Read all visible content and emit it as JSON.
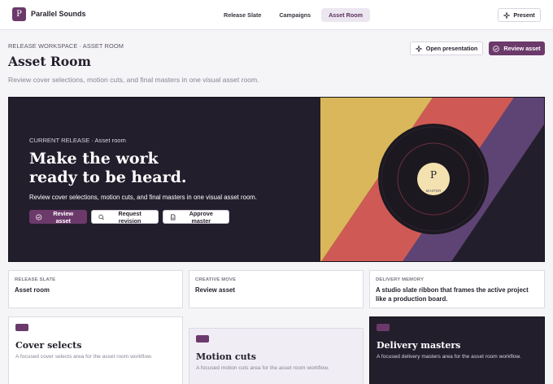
{
  "app": {
    "logo_letter": "P",
    "brand": "Parallel Sounds",
    "present_label": "Present"
  },
  "nav": {
    "items": [
      {
        "label": "Release Slate",
        "active": false
      },
      {
        "label": "Campaigns",
        "active": false
      },
      {
        "label": "Asset Room",
        "active": true
      }
    ]
  },
  "header": {
    "eyebrow": "RELEASE WORKSPACE · ASSET ROOM",
    "title": "Asset Room",
    "subtitle": "Review cover selections, motion cuts, and final masters in one visual asset room.",
    "open_label": "Open presentation",
    "review_label": "Review asset"
  },
  "hero": {
    "eyebrow": "CURRENT RELEASE · Asset room",
    "title_line1": "Make the work",
    "title_line2": "ready to be heard.",
    "description": "Review cover selections, motion cuts, and final masters in one visual asset room.",
    "buttons": {
      "review": "Review asset",
      "revision": "Request revision",
      "approve": "Approve master"
    },
    "record": {
      "letter": "P",
      "label": "MASTER"
    }
  },
  "info_cards": [
    {
      "label": "RELEASE SLATE",
      "value": "Asset room"
    },
    {
      "label": "CREATIVE MOVE",
      "value": "Review asset"
    },
    {
      "label": "DELIVERY MEMORY",
      "value": "A studio slate ribbon that frames the active project like a production board."
    }
  ],
  "feature_cards": [
    {
      "title": "Cover selects",
      "description": "A focused cover selects area for the asset room workflow."
    },
    {
      "title": "Motion cuts",
      "description": "A focused motion cuts area for the asset room workflow."
    },
    {
      "title": "Delivery masters",
      "description": "A focused delivery masters area for the asset room workflow."
    }
  ],
  "colors": {
    "accent": "#6b3a6b",
    "hero_bg": "#231e2c",
    "stripe_yellow": "#d9b75a",
    "stripe_red": "#cf5a55",
    "stripe_purple": "#5e4474"
  },
  "icons": {
    "present": "sparkle-icon",
    "review": "check-circle-icon",
    "revision": "search-icon",
    "approve": "document-icon"
  }
}
